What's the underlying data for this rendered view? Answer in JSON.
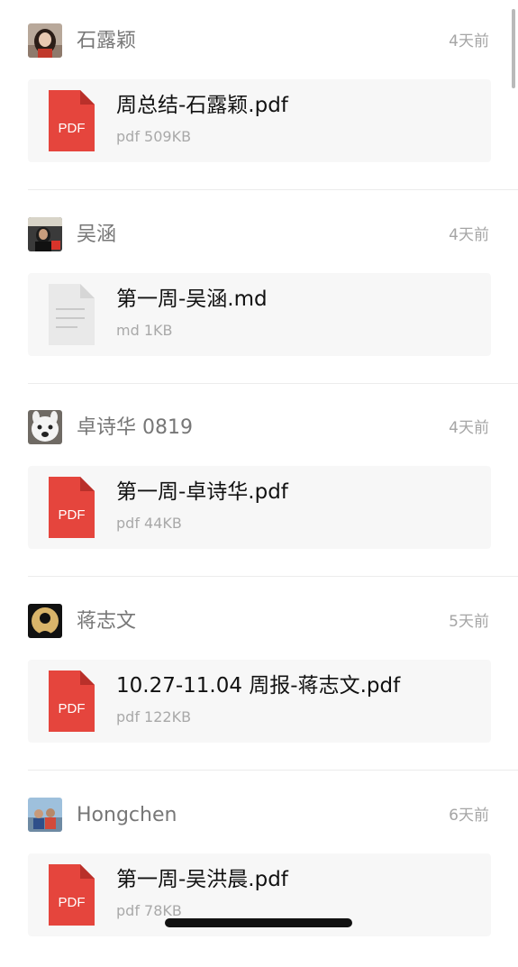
{
  "posts": [
    {
      "user": "石露颖",
      "time": "4天前",
      "file": {
        "name": "周总结-石露颖.pdf",
        "meta": "pdf 509KB",
        "icon_label": "PDF",
        "icon": "pdf-file-icon"
      }
    },
    {
      "user": "吴涵",
      "time": "4天前",
      "file": {
        "name": "第一周-吴涵.md",
        "meta": "md 1KB",
        "icon_label": "",
        "icon": "document-file-icon"
      }
    },
    {
      "user": "卓诗华 0819",
      "time": "4天前",
      "file": {
        "name": "第一周-卓诗华.pdf",
        "meta": "pdf 44KB",
        "icon_label": "PDF",
        "icon": "pdf-file-icon"
      }
    },
    {
      "user": "蒋志文",
      "time": "5天前",
      "file": {
        "name": "10.27-11.04 周报-蒋志文.pdf",
        "meta": "pdf 122KB",
        "icon_label": "PDF",
        "icon": "pdf-file-icon"
      }
    },
    {
      "user": "Hongchen",
      "time": "6天前",
      "file": {
        "name": "第一周-吴洪晨.pdf",
        "meta": "pdf 78KB",
        "icon_label": "PDF",
        "icon": "pdf-file-icon"
      }
    }
  ],
  "colors": {
    "pdf_red": "#e5453d",
    "doc_gray": "#e9e9e9",
    "card_bg": "#f7f7f7",
    "meta_text": "#a9a9a9"
  }
}
